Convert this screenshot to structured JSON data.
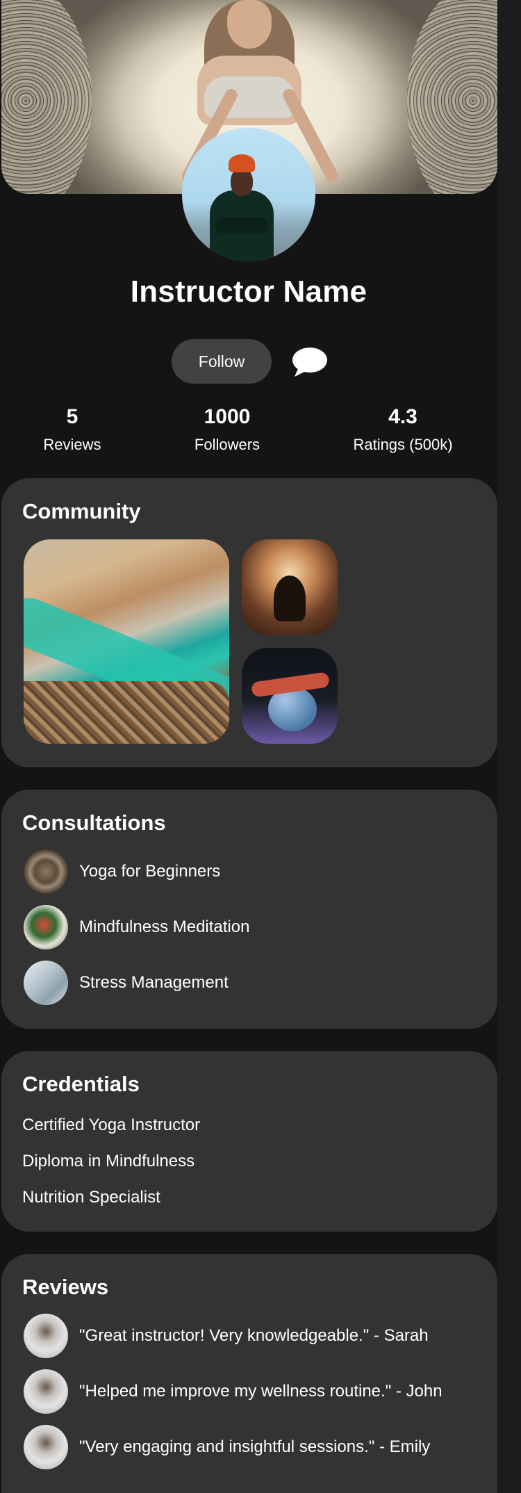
{
  "profile": {
    "name": "Instructor Name",
    "follow_label": "Follow"
  },
  "stats": [
    {
      "value": "5",
      "label": "Reviews"
    },
    {
      "value": "1000",
      "label": "Followers"
    },
    {
      "value": "4.3",
      "label": "Ratings (500k)"
    }
  ],
  "community": {
    "title": "Community"
  },
  "consultations": {
    "title": "Consultations",
    "items": [
      {
        "label": "Yoga for Beginners"
      },
      {
        "label": "Mindfulness Meditation"
      },
      {
        "label": "Stress Management"
      }
    ]
  },
  "credentials": {
    "title": "Credentials",
    "items": [
      "Certified Yoga Instructor",
      "Diploma in Mindfulness",
      "Nutrition Specialist"
    ]
  },
  "reviews": {
    "title": "Reviews",
    "items": [
      {
        "text": "\"Great instructor! Very knowledgeable.\" - Sarah"
      },
      {
        "text": "\"Helped me improve my wellness routine.\" - John"
      },
      {
        "text": "\"Very engaging and insightful sessions.\" - Emily"
      }
    ]
  },
  "icons": {
    "chat": "chat-bubble-icon"
  },
  "colors": {
    "background": "#141414",
    "card": "#333333",
    "button": "#424242",
    "text": "#ffffff"
  }
}
